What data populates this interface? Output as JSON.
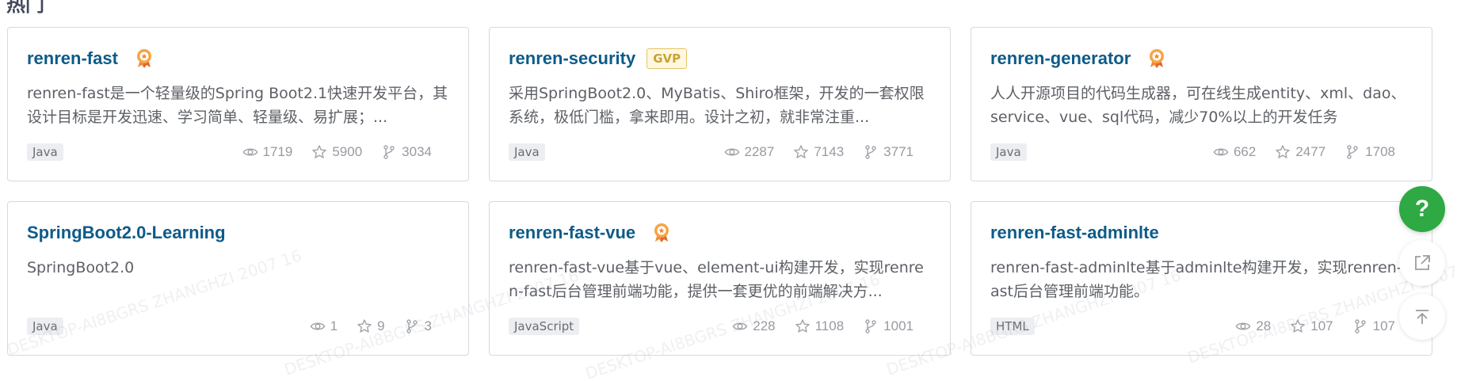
{
  "section": {
    "title": "热门"
  },
  "projects": [
    {
      "title": "renren-fast",
      "badge": "medal",
      "description": "renren-fast是一个轻量级的Spring Boot2.1快速开发平台，其设计目标是开发迅速、学习简单、轻量级、易扩展；...",
      "language": "Java",
      "views": "1719",
      "stars": "5900",
      "forks": "3034"
    },
    {
      "title": "renren-security",
      "badge": "GVP",
      "description": "采用SpringBoot2.0、MyBatis、Shiro框架，开发的一套权限系统，极低门槛，拿来即用。设计之初，就非常注重...",
      "language": "Java",
      "views": "2287",
      "stars": "7143",
      "forks": "3771"
    },
    {
      "title": "renren-generator",
      "badge": "medal",
      "description": "人人开源项目的代码生成器，可在线生成entity、xml、dao、service、vue、sql代码，减少70%以上的开发任务",
      "language": "Java",
      "views": "662",
      "stars": "2477",
      "forks": "1708"
    },
    {
      "title": "SpringBoot2.0-Learning",
      "badge": "",
      "description": "SpringBoot2.0",
      "language": "Java",
      "views": "1",
      "stars": "9",
      "forks": "3"
    },
    {
      "title": "renren-fast-vue",
      "badge": "medal",
      "description": "renren-fast-vue基于vue、element-ui构建开发，实现renren-fast后台管理前端功能，提供一套更优的前端解决方...",
      "language": "JavaScript",
      "views": "228",
      "stars": "1108",
      "forks": "1001"
    },
    {
      "title": "renren-fast-adminlte",
      "badge": "",
      "description": "renren-fast-adminlte基于adminlte构建开发，实现renren-fast后台管理前端功能。",
      "language": "HTML",
      "views": "28",
      "stars": "107",
      "forks": "107"
    }
  ],
  "watermark": "DESKTOP-AI8BGRS ZHANGHZI 2007 16",
  "floating": {
    "help": "?"
  },
  "colors": {
    "title": "#0d5b89",
    "help_green": "#2ea944",
    "gvp_gold": "#c9a234"
  }
}
